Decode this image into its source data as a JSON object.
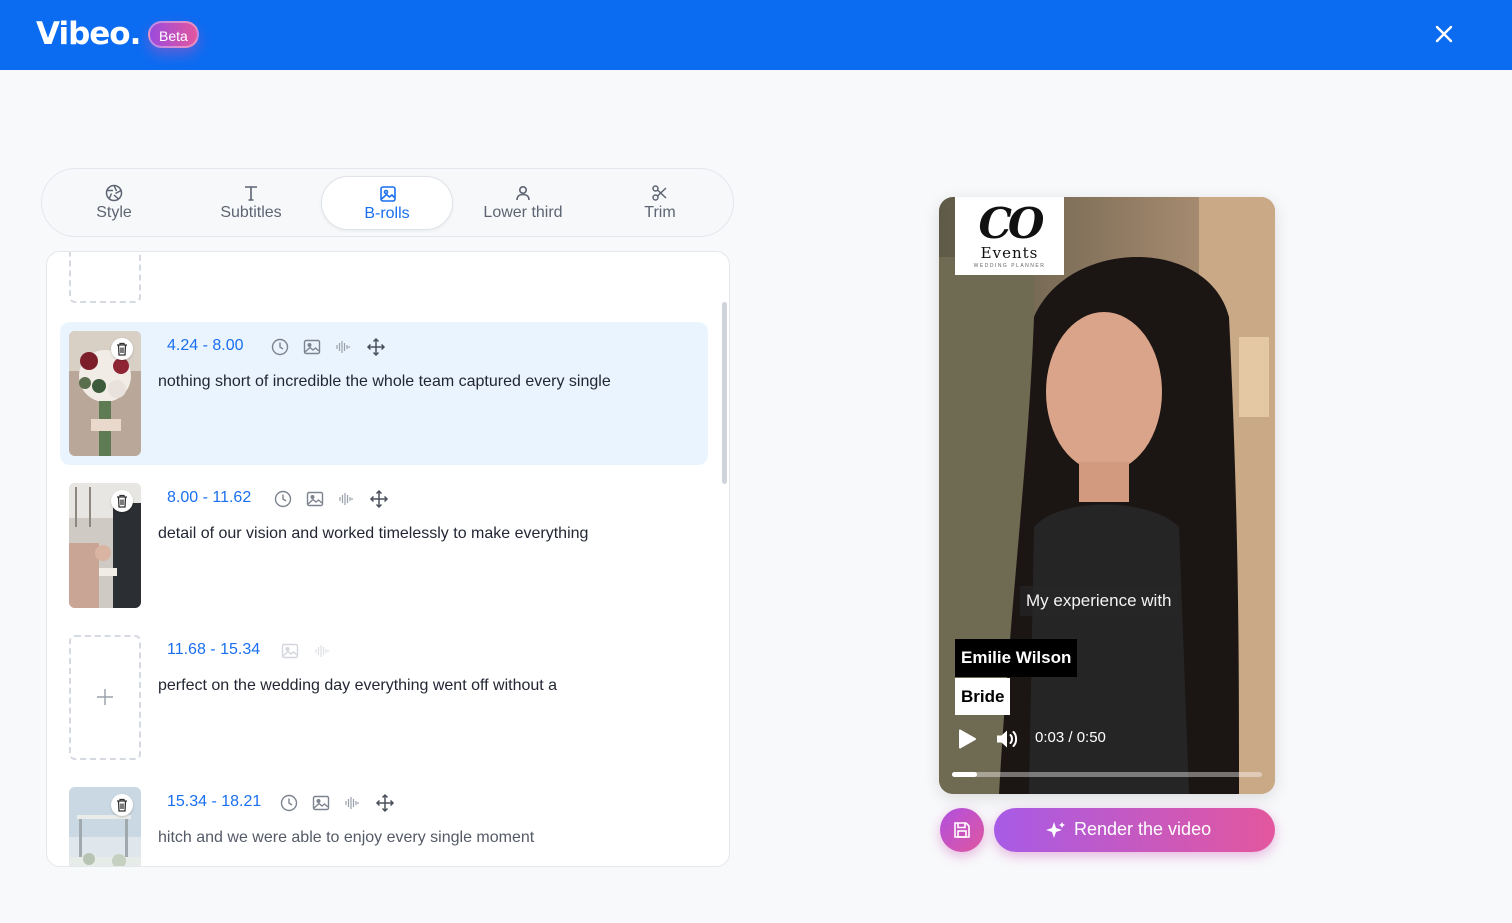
{
  "app": {
    "name": "Vibeo.",
    "badge": "Beta"
  },
  "tabs": [
    {
      "label": "Style",
      "icon": "aperture-icon"
    },
    {
      "label": "Subtitles",
      "icon": "text-icon"
    },
    {
      "label": "B-rolls",
      "icon": "image-icon",
      "active": true
    },
    {
      "label": "Lower third",
      "icon": "user-icon"
    },
    {
      "label": "Trim",
      "icon": "scissors-icon"
    }
  ],
  "segments": [
    {
      "time": "4.24 - 8.00",
      "text": "nothing short of incredible the whole team captured every single",
      "has_broll": true,
      "selected": true
    },
    {
      "time": "8.00 - 11.62",
      "text": "detail of our vision and worked timelessly to make everything",
      "has_broll": true
    },
    {
      "time": "11.68 - 15.34",
      "text": "perfect on the wedding day everything went off without a",
      "has_broll": false
    },
    {
      "time": "15.34 - 18.21",
      "text": "hitch and we were able to enjoy every single moment",
      "has_broll": true
    }
  ],
  "video": {
    "logo": {
      "big": "CO",
      "mid": "Events",
      "small": "WEDDING PLANNER"
    },
    "caption": "My experience with",
    "lower_third": {
      "name": "Emilie Wilson",
      "role": "Bride"
    },
    "time": "0:03 / 0:50",
    "progress": 0.08
  },
  "actions": {
    "render": "Render the video"
  },
  "colors": {
    "header": "#0b6cf2",
    "accent": "#1a6ff0",
    "gradient_start": "#a75be6",
    "gradient_end": "#e3579e"
  }
}
